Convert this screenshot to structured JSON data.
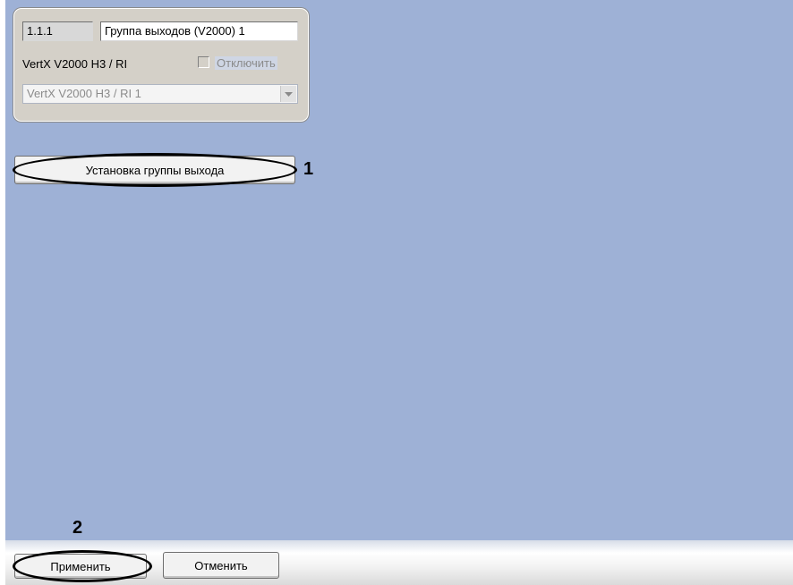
{
  "group": {
    "address": "1.1.1",
    "name": "Группа выходов (V2000) 1",
    "device_label": "VertX V2000 H3 / RI",
    "disable_label": "Отключить",
    "disable_checked": false,
    "device_select_value": "VertX V2000 H3 / RI 1"
  },
  "actions": {
    "setup_label": "Установка группы выхода"
  },
  "footer": {
    "apply_label": "Применить",
    "cancel_label": "Отменить"
  },
  "callouts": {
    "one": "1",
    "two": "2"
  },
  "icons": {
    "select_arrow": "chevron-down-icon"
  },
  "colors": {
    "panel_background": "#9eb1d6",
    "group_background": "#d4d0c8"
  }
}
